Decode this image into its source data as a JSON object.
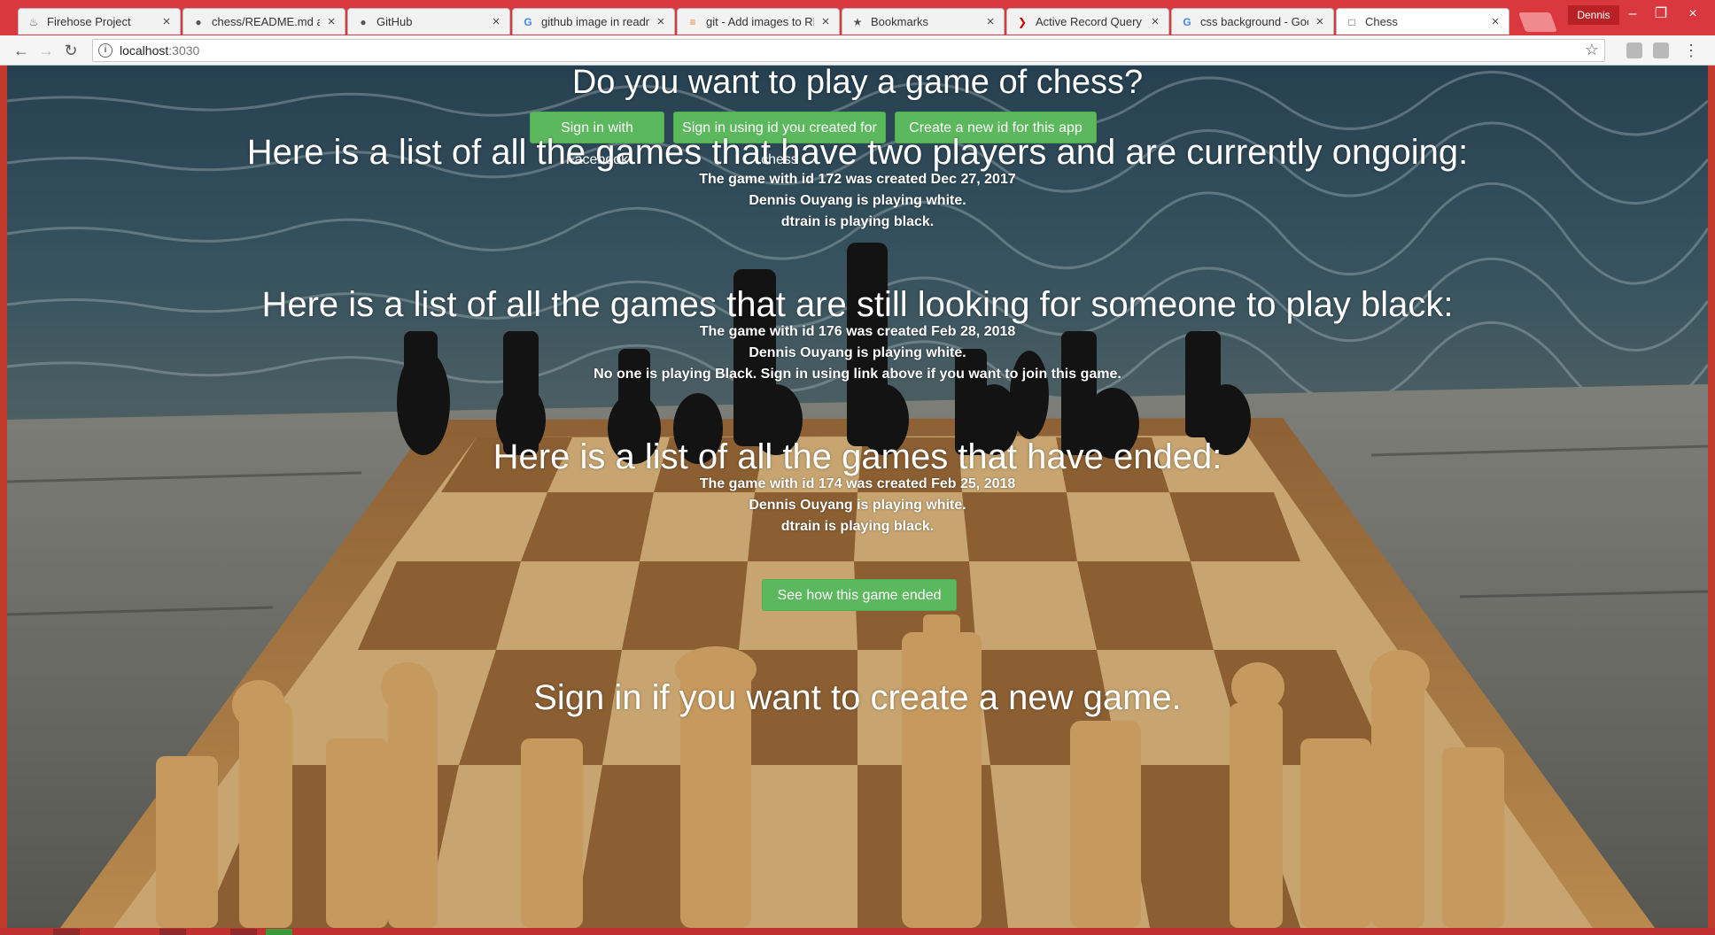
{
  "browser": {
    "tabs": [
      {
        "title": "Firehose Project",
        "icon": "firehose-icon"
      },
      {
        "title": "chess/README.md at m",
        "icon": "github-icon"
      },
      {
        "title": "GitHub",
        "icon": "github-icon"
      },
      {
        "title": "github image in readme",
        "icon": "google-icon"
      },
      {
        "title": "git - Add images to REA",
        "icon": "stackoverflow-icon"
      },
      {
        "title": "Bookmarks",
        "icon": "star-icon"
      },
      {
        "title": "Active Record Query Int",
        "icon": "rails-icon"
      },
      {
        "title": "css background - Googl",
        "icon": "google-icon"
      },
      {
        "title": "Chess",
        "icon": "page-icon"
      }
    ],
    "active_tab": 8,
    "profile_name": "Dennis",
    "url_host": "localhost",
    "url_port": ":3030",
    "accent_color": "#d8383e"
  },
  "page": {
    "heading": "Do you want to play a game of chess?",
    "buttons": {
      "facebook": "Sign in with Facebook",
      "chess_id": "Sign in using id you created for chess",
      "create_id": "Create a new id for this app"
    },
    "ongoing": {
      "heading": "Here is a list of all the games that have two players and are currently ongoing:",
      "lines": [
        "The game with id 172 was created Dec 27, 2017",
        "Dennis Ouyang is playing white.",
        "dtrain is playing black."
      ]
    },
    "open": {
      "heading": "Here is a list of all the games that are still looking for someone to play black:",
      "lines": [
        "The game with id 176 was created Feb 28, 2018",
        "Dennis Ouyang is playing white.",
        "No one is playing Black. Sign in using link above if you want to join this game."
      ]
    },
    "ended": {
      "heading": "Here is a list of all the games that have ended:",
      "lines": [
        "The game with id 174 was created Feb 25, 2018",
        "Dennis Ouyang is playing white.",
        "dtrain is playing black."
      ],
      "button": "See how this game ended"
    },
    "footer_text": "Sign in if you want to create a new game.",
    "button_color": "#5cb85c"
  }
}
